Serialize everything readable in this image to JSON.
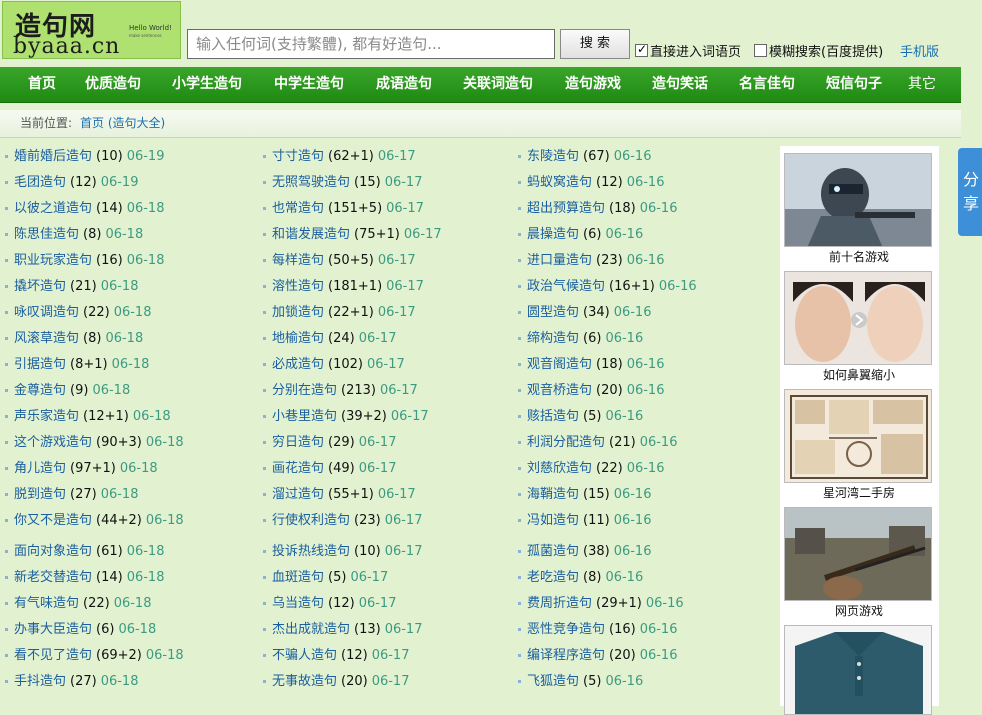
{
  "logo": {
    "cn": "造句网",
    "en": "byaaa.cn",
    "tag": "Hello World!",
    "tag_small": "make sentences"
  },
  "search": {
    "placeholder": "输入任何词(支持繁體), 都有好造句...",
    "button": "搜 索"
  },
  "options": {
    "direct": "直接进入词语页",
    "fuzzy": "模糊搜索(百度提供)",
    "mobile": "手机版"
  },
  "nav": [
    "首页",
    "优质造句",
    "小学生造句",
    "中学生造句",
    "成语造句",
    "关联词造句",
    "造句游戏",
    "造句笑话",
    "名言佳句",
    "短信句子",
    "其它"
  ],
  "breadcrumb": {
    "label": "当前位置:",
    "home": "首页 (造句大全)"
  },
  "columns": [
    [
      {
        "w": "婚前婚后造句",
        "c": "(10)",
        "d": "06-19"
      },
      {
        "w": "毛团造句",
        "c": "(12)",
        "d": "06-19"
      },
      {
        "w": "以彼之道造句",
        "c": "(14)",
        "d": "06-18"
      },
      {
        "w": "陈思佳造句",
        "c": "(8)",
        "d": "06-18"
      },
      {
        "w": "职业玩家造句",
        "c": "(16)",
        "d": "06-18"
      },
      {
        "w": "撬坏造句",
        "c": "(21)",
        "d": "06-18"
      },
      {
        "w": "咏叹调造句",
        "c": "(22)",
        "d": "06-18"
      },
      {
        "w": "风滚草造句",
        "c": "(8)",
        "d": "06-18"
      },
      {
        "w": "引据造句",
        "c": "(8+1)",
        "d": "06-18"
      },
      {
        "w": "金尊造句",
        "c": "(9)",
        "d": "06-18"
      },
      {
        "w": "声乐家造句",
        "c": "(12+1)",
        "d": "06-18"
      },
      {
        "w": "这个游戏造句",
        "c": "(90+3)",
        "d": "06-18"
      },
      {
        "w": "角儿造句",
        "c": "(97+1)",
        "d": "06-18"
      },
      {
        "w": "脱到造句",
        "c": "(27)",
        "d": "06-18"
      },
      {
        "w": "你又不是造句",
        "c": "(44+2)",
        "d": "06-18"
      },
      {
        "w": "面向对象造句",
        "c": "(61)",
        "d": "06-18"
      },
      {
        "w": "新老交替造句",
        "c": "(14)",
        "d": "06-18"
      },
      {
        "w": "有气味造句",
        "c": "(22)",
        "d": "06-18"
      },
      {
        "w": "办事大臣造句",
        "c": "(6)",
        "d": "06-18"
      },
      {
        "w": "看不见了造句",
        "c": "(69+2)",
        "d": "06-18"
      },
      {
        "w": "手抖造句",
        "c": "(27)",
        "d": "06-18"
      }
    ],
    [
      {
        "w": "寸寸造句",
        "c": "(62+1)",
        "d": "06-17"
      },
      {
        "w": "无照驾驶造句",
        "c": "(15)",
        "d": "06-17"
      },
      {
        "w": "也常造句",
        "c": "(151+5)",
        "d": "06-17"
      },
      {
        "w": "和谐发展造句",
        "c": "(75+1)",
        "d": "06-17"
      },
      {
        "w": "每样造句",
        "c": "(50+5)",
        "d": "06-17"
      },
      {
        "w": "溶性造句",
        "c": "(181+1)",
        "d": "06-17"
      },
      {
        "w": "加锁造句",
        "c": "(22+1)",
        "d": "06-17"
      },
      {
        "w": "地榆造句",
        "c": "(24)",
        "d": "06-17"
      },
      {
        "w": "必成造句",
        "c": "(102)",
        "d": "06-17"
      },
      {
        "w": "分别在造句",
        "c": "(213)",
        "d": "06-17"
      },
      {
        "w": "小巷里造句",
        "c": "(39+2)",
        "d": "06-17"
      },
      {
        "w": "穷日造句",
        "c": "(29)",
        "d": "06-17"
      },
      {
        "w": "画花造句",
        "c": "(49)",
        "d": "06-17"
      },
      {
        "w": "溜过造句",
        "c": "(55+1)",
        "d": "06-17"
      },
      {
        "w": "行使权利造句",
        "c": "(23)",
        "d": "06-17"
      },
      {
        "w": "投诉热线造句",
        "c": "(10)",
        "d": "06-17"
      },
      {
        "w": "血斑造句",
        "c": "(5)",
        "d": "06-17"
      },
      {
        "w": "乌当造句",
        "c": "(12)",
        "d": "06-17"
      },
      {
        "w": "杰出成就造句",
        "c": "(13)",
        "d": "06-17"
      },
      {
        "w": "不骗人造句",
        "c": "(12)",
        "d": "06-17"
      },
      {
        "w": "无事故造句",
        "c": "(20)",
        "d": "06-17"
      }
    ],
    [
      {
        "w": "东陵造句",
        "c": "(67)",
        "d": "06-16"
      },
      {
        "w": "蚂蚁窝造句",
        "c": "(12)",
        "d": "06-16"
      },
      {
        "w": "超出预算造句",
        "c": "(18)",
        "d": "06-16"
      },
      {
        "w": "晨操造句",
        "c": "(6)",
        "d": "06-16"
      },
      {
        "w": "进口量造句",
        "c": "(23)",
        "d": "06-16"
      },
      {
        "w": "政治气候造句",
        "c": "(16+1)",
        "d": "06-16"
      },
      {
        "w": "圆型造句",
        "c": "(34)",
        "d": "06-16"
      },
      {
        "w": "缔构造句",
        "c": "(6)",
        "d": "06-16"
      },
      {
        "w": "观音阁造句",
        "c": "(18)",
        "d": "06-16"
      },
      {
        "w": "观音桥造句",
        "c": "(20)",
        "d": "06-16"
      },
      {
        "w": "赅括造句",
        "c": "(5)",
        "d": "06-16"
      },
      {
        "w": "利润分配造句",
        "c": "(21)",
        "d": "06-16"
      },
      {
        "w": "刘慈欣造句",
        "c": "(22)",
        "d": "06-16"
      },
      {
        "w": "海鞘造句",
        "c": "(15)",
        "d": "06-16"
      },
      {
        "w": "冯如造句",
        "c": "(11)",
        "d": "06-16"
      },
      {
        "w": "孤菌造句",
        "c": "(38)",
        "d": "06-16"
      },
      {
        "w": "老吃造句",
        "c": "(8)",
        "d": "06-16"
      },
      {
        "w": "费周折造句",
        "c": "(29+1)",
        "d": "06-16"
      },
      {
        "w": "恶性竞争造句",
        "c": "(16)",
        "d": "06-16"
      },
      {
        "w": "编译程序造句",
        "c": "(20)",
        "d": "06-16"
      },
      {
        "w": "飞狐造句",
        "c": "(5)",
        "d": "06-16"
      }
    ]
  ],
  "sidebar": [
    "前十名游戏",
    "如何鼻翼缩小",
    "星河湾二手房",
    "网页游戏",
    ""
  ],
  "share": "分享",
  "colors": {
    "nav": "#2a9b1c",
    "link": "#1a5e9e",
    "date": "#3c9a80",
    "bg": "#e2f2d1"
  }
}
